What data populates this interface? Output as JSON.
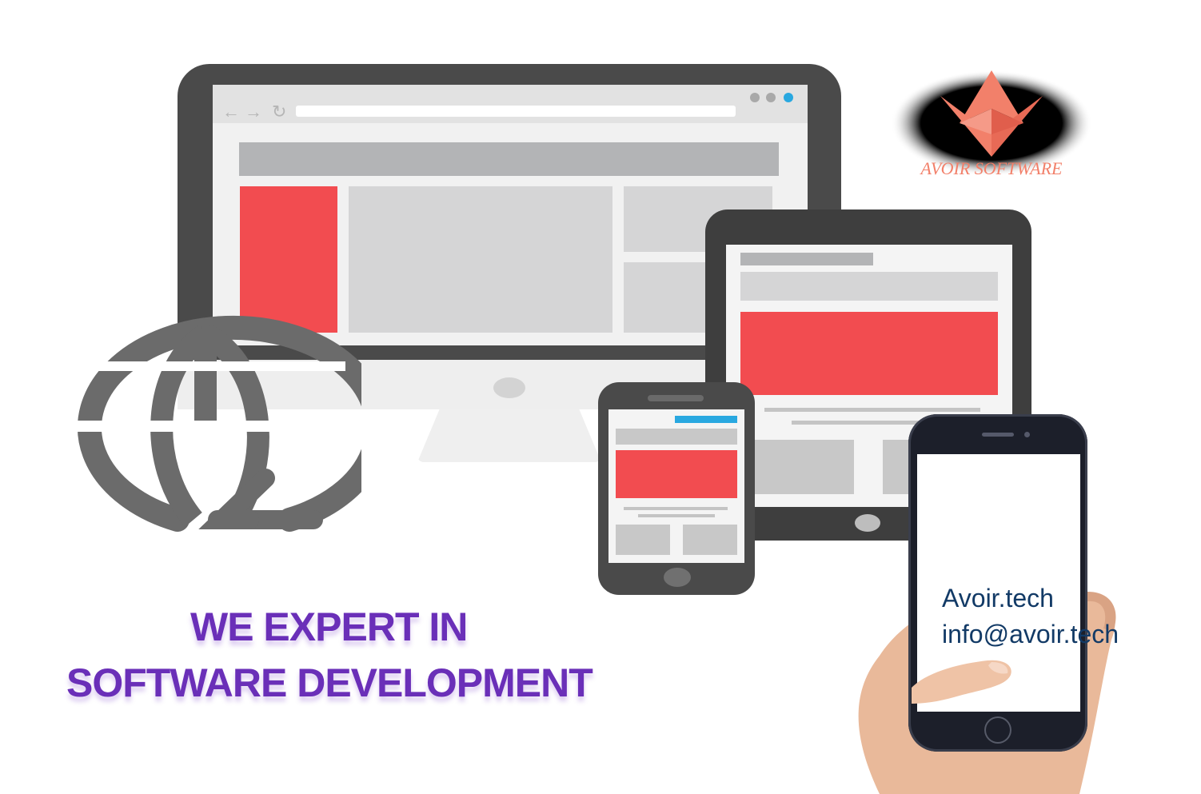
{
  "headline": {
    "line1": "WE EXPERT IN",
    "line2": "SOFTWARE DEVELOPMENT",
    "color": "#6a2fb8"
  },
  "contact": {
    "website": "Avoir.tech",
    "email": "info@avoir.tech",
    "color": "#123a66"
  },
  "logo": {
    "text": "AVOIR SOFTWARE"
  },
  "colors": {
    "accent_red": "#f24c50",
    "accent_blue": "#29a8e0",
    "device_dark": "#4a4a4a"
  },
  "icons": {
    "globe": "globe-with-refresh-arrow-icon",
    "browser_back": "←",
    "browser_forward": "→",
    "browser_refresh": "↻"
  }
}
